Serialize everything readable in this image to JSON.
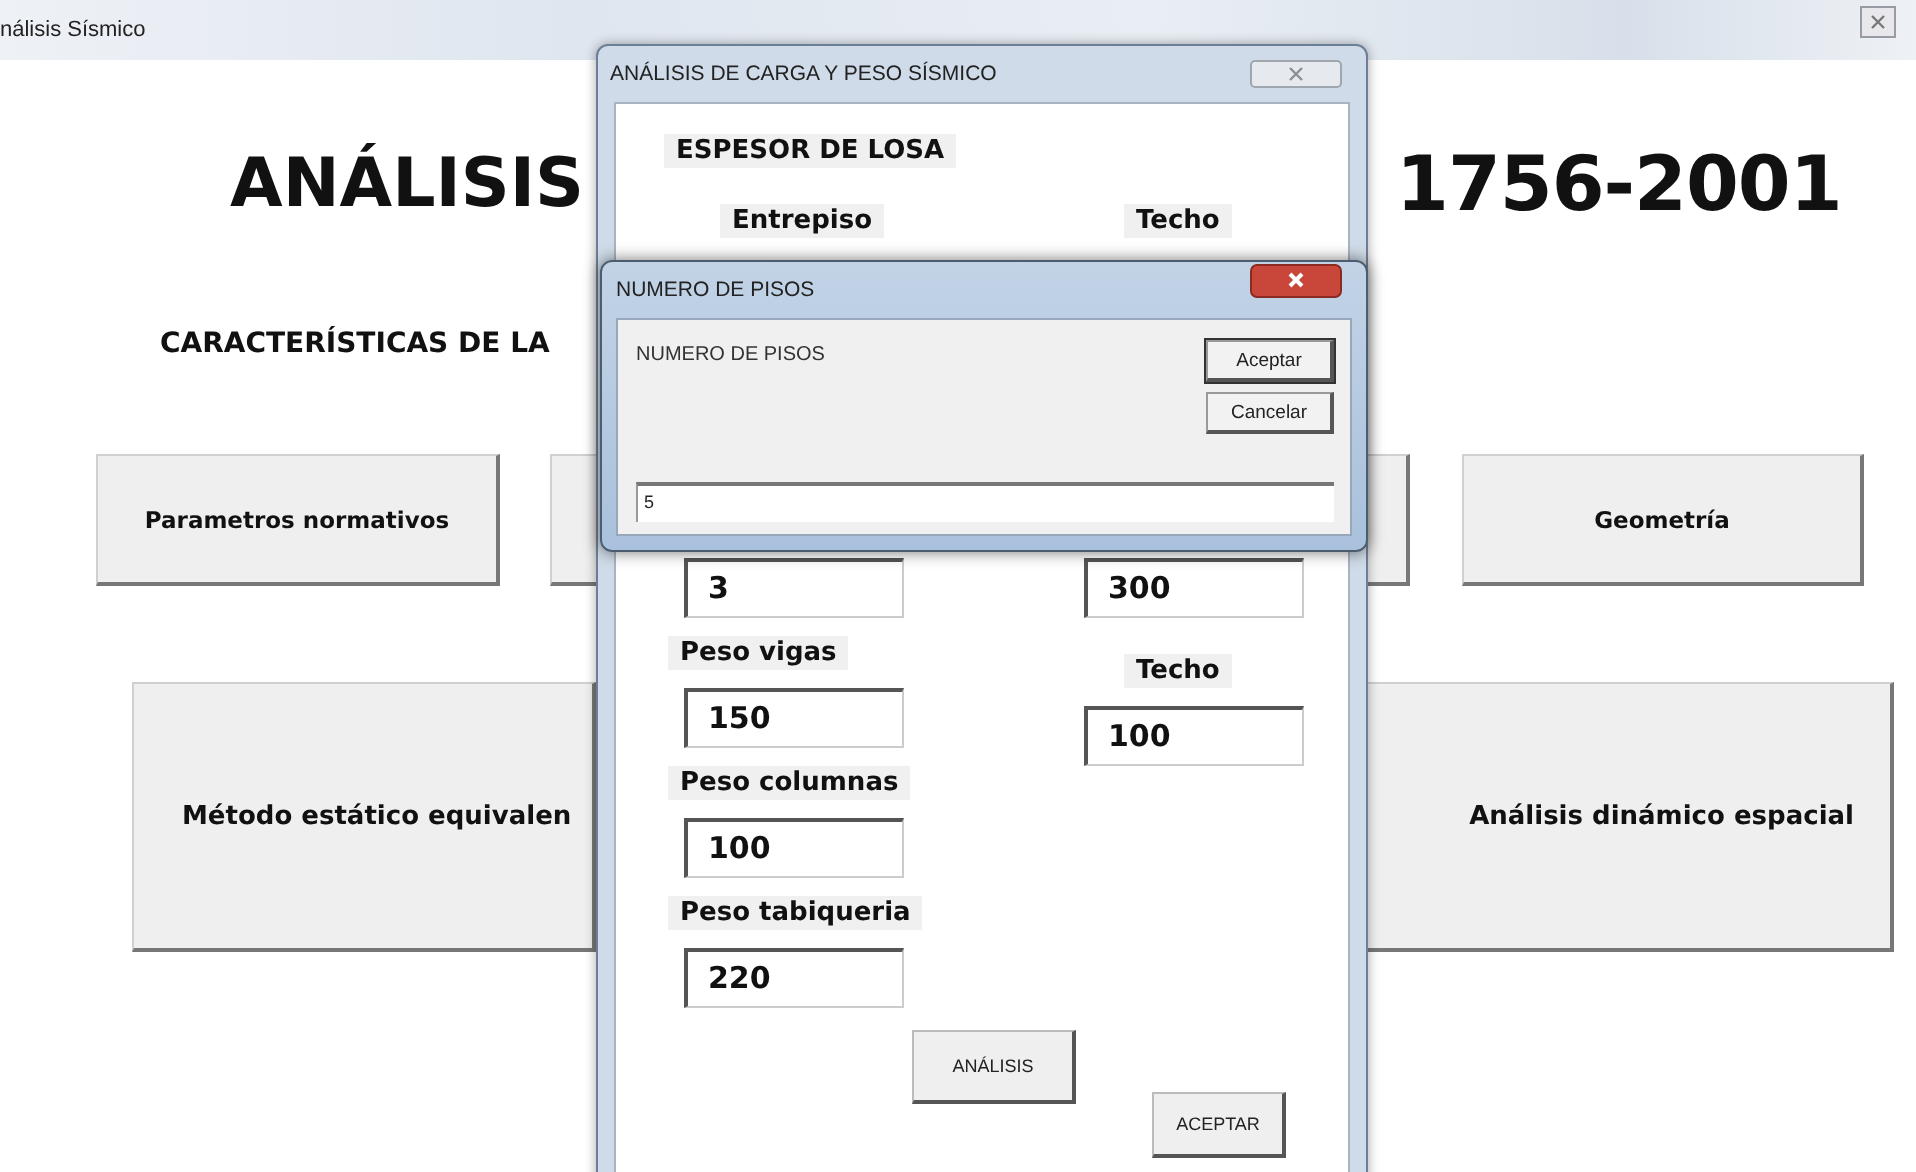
{
  "main_window": {
    "title": "nálisis Sísmico",
    "heading_left": "ANÁLISIS",
    "heading_right": "1756-2001",
    "subtitle": "CARACTERÍSTICAS DE LA",
    "buttons": [
      {
        "label": "Parametros normativos",
        "kind": "small"
      },
      {
        "label": "Geometría",
        "kind": "small"
      },
      {
        "label": "Método estático equivalen",
        "kind": "large"
      },
      {
        "label": "Análisis dinámico espacial",
        "kind": "large"
      }
    ]
  },
  "load_dialog": {
    "title": "ANÁLISIS DE CARGA Y PESO SÍSMICO",
    "section": "ESPESOR DE LOSA",
    "left_column": [
      {
        "kind": "label",
        "text": "Entrepiso"
      },
      {
        "kind": "input",
        "value": "3"
      },
      {
        "kind": "label",
        "text": "Peso vigas"
      },
      {
        "kind": "input",
        "value": "150"
      },
      {
        "kind": "label",
        "text": "Peso columnas"
      },
      {
        "kind": "input",
        "value": "100"
      },
      {
        "kind": "label",
        "text": "Peso tabiqueria"
      },
      {
        "kind": "input",
        "value": "220"
      }
    ],
    "right_column": [
      {
        "kind": "label",
        "text": "Techo"
      },
      {
        "kind": "input",
        "value": "300"
      },
      {
        "kind": "label",
        "text": "Techo"
      },
      {
        "kind": "input",
        "value": "100"
      }
    ],
    "analysis_button": "ANÁLISIS",
    "accept_button": "ACEPTAR"
  },
  "input_dialog": {
    "title": "NUMERO DE PISOS",
    "prompt": "NUMERO DE PISOS",
    "buttons": [
      "Aceptar",
      "Cancelar"
    ],
    "value": "5"
  }
}
